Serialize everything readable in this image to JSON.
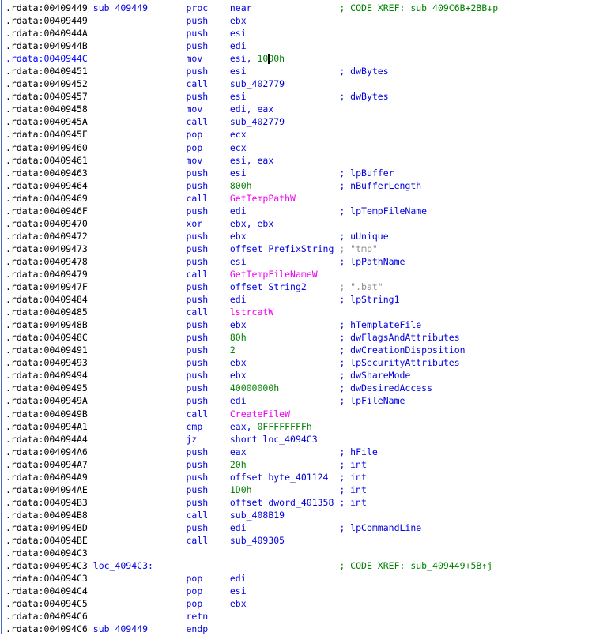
{
  "app": "disassembler-listing",
  "colors": {
    "k": "#000000",
    "b": "#0202e0",
    "g": "#008200",
    "m": "#ef00ef",
    "gy": "#8c8c8c",
    "hl": "#0000ff",
    "border": "#4a68c8",
    "background": "#ffffff"
  },
  "listing": {
    "section": ".rdata",
    "function": "sub_409449",
    "lines": [
      {
        "a": ".rdata:00409449",
        "n": "sub_409449",
        "m": "proc",
        "o": [
          [
            "b",
            "near"
          ]
        ],
        "c": "; CODE XREF: sub_409C6B+2BB↓p",
        "ct": "g"
      },
      {
        "a": ".rdata:00409449",
        "m": "push",
        "o": [
          [
            "b",
            "ebx"
          ]
        ]
      },
      {
        "a": ".rdata:0040944A",
        "m": "push",
        "o": [
          [
            "b",
            "esi"
          ]
        ]
      },
      {
        "a": ".rdata:0040944B",
        "m": "push",
        "o": [
          [
            "b",
            "edi"
          ]
        ]
      },
      {
        "a": ".rdata:0040944C",
        "hl": true,
        "m": "mov",
        "o": [
          [
            "b",
            "esi, "
          ],
          [
            "g",
            "1000h"
          ]
        ],
        "caret": 48
      },
      {
        "a": ".rdata:00409451",
        "m": "push",
        "o": [
          [
            "b",
            "esi"
          ]
        ],
        "c": "; dwBytes",
        "ct": "b"
      },
      {
        "a": ".rdata:00409452",
        "m": "call",
        "o": [
          [
            "b",
            "sub_402779"
          ]
        ]
      },
      {
        "a": ".rdata:00409457",
        "m": "push",
        "o": [
          [
            "b",
            "esi"
          ]
        ],
        "c": "; dwBytes",
        "ct": "b"
      },
      {
        "a": ".rdata:00409458",
        "m": "mov",
        "o": [
          [
            "b",
            "edi, eax"
          ]
        ]
      },
      {
        "a": ".rdata:0040945A",
        "m": "call",
        "o": [
          [
            "b",
            "sub_402779"
          ]
        ]
      },
      {
        "a": ".rdata:0040945F",
        "m": "pop",
        "o": [
          [
            "b",
            "ecx"
          ]
        ]
      },
      {
        "a": ".rdata:00409460",
        "m": "pop",
        "o": [
          [
            "b",
            "ecx"
          ]
        ]
      },
      {
        "a": ".rdata:00409461",
        "m": "mov",
        "o": [
          [
            "b",
            "esi, eax"
          ]
        ]
      },
      {
        "a": ".rdata:00409463",
        "m": "push",
        "o": [
          [
            "b",
            "esi"
          ]
        ],
        "c": "; lpBuffer",
        "ct": "b"
      },
      {
        "a": ".rdata:00409464",
        "m": "push",
        "o": [
          [
            "g",
            "800h"
          ]
        ],
        "c": "; nBufferLength",
        "ct": "b"
      },
      {
        "a": ".rdata:00409469",
        "m": "call",
        "o": [
          [
            "m",
            "GetTempPathW"
          ]
        ]
      },
      {
        "a": ".rdata:0040946F",
        "m": "push",
        "o": [
          [
            "b",
            "edi"
          ]
        ],
        "c": "; lpTempFileName",
        "ct": "b"
      },
      {
        "a": ".rdata:00409470",
        "m": "xor",
        "o": [
          [
            "b",
            "ebx, ebx"
          ]
        ]
      },
      {
        "a": ".rdata:00409472",
        "m": "push",
        "o": [
          [
            "b",
            "ebx"
          ]
        ],
        "c": "; uUnique",
        "ct": "b"
      },
      {
        "a": ".rdata:00409473",
        "m": "push",
        "o": [
          [
            "b",
            "offset PrefixString"
          ]
        ],
        "c": "; \"tmp\"",
        "ct": "gy"
      },
      {
        "a": ".rdata:00409478",
        "m": "push",
        "o": [
          [
            "b",
            "esi"
          ]
        ],
        "c": "; lpPathName",
        "ct": "b"
      },
      {
        "a": ".rdata:00409479",
        "m": "call",
        "o": [
          [
            "m",
            "GetTempFileNameW"
          ]
        ]
      },
      {
        "a": ".rdata:0040947F",
        "m": "push",
        "o": [
          [
            "b",
            "offset String2"
          ]
        ],
        "c": "; \".bat\"",
        "ct": "gy"
      },
      {
        "a": ".rdata:00409484",
        "m": "push",
        "o": [
          [
            "b",
            "edi"
          ]
        ],
        "c": "; lpString1",
        "ct": "b"
      },
      {
        "a": ".rdata:00409485",
        "m": "call",
        "o": [
          [
            "m",
            "lstrcatW"
          ]
        ]
      },
      {
        "a": ".rdata:0040948B",
        "m": "push",
        "o": [
          [
            "b",
            "ebx"
          ]
        ],
        "c": "; hTemplateFile",
        "ct": "b"
      },
      {
        "a": ".rdata:0040948C",
        "m": "push",
        "o": [
          [
            "g",
            "80h"
          ]
        ],
        "c": "; dwFlagsAndAttributes",
        "ct": "b"
      },
      {
        "a": ".rdata:00409491",
        "m": "push",
        "o": [
          [
            "g",
            "2"
          ]
        ],
        "c": "; dwCreationDisposition",
        "ct": "b"
      },
      {
        "a": ".rdata:00409493",
        "m": "push",
        "o": [
          [
            "b",
            "ebx"
          ]
        ],
        "c": "; lpSecurityAttributes",
        "ct": "b"
      },
      {
        "a": ".rdata:00409494",
        "m": "push",
        "o": [
          [
            "b",
            "ebx"
          ]
        ],
        "c": "; dwShareMode",
        "ct": "b"
      },
      {
        "a": ".rdata:00409495",
        "m": "push",
        "o": [
          [
            "g",
            "40000000h"
          ]
        ],
        "c": "; dwDesiredAccess",
        "ct": "b"
      },
      {
        "a": ".rdata:0040949A",
        "m": "push",
        "o": [
          [
            "b",
            "edi"
          ]
        ],
        "c": "; lpFileName",
        "ct": "b"
      },
      {
        "a": ".rdata:0040949B",
        "m": "call",
        "o": [
          [
            "m",
            "CreateFileW"
          ]
        ]
      },
      {
        "a": ".rdata:004094A1",
        "m": "cmp",
        "o": [
          [
            "b",
            "eax, "
          ],
          [
            "g",
            "0FFFFFFFFh"
          ]
        ]
      },
      {
        "a": ".rdata:004094A4",
        "m": "jz",
        "o": [
          [
            "b",
            "short loc_4094C3"
          ]
        ]
      },
      {
        "a": ".rdata:004094A6",
        "m": "push",
        "o": [
          [
            "b",
            "eax"
          ]
        ],
        "c": "; hFile",
        "ct": "b"
      },
      {
        "a": ".rdata:004094A7",
        "m": "push",
        "o": [
          [
            "g",
            "20h"
          ]
        ],
        "c": "; int",
        "ct": "b"
      },
      {
        "a": ".rdata:004094A9",
        "m": "push",
        "o": [
          [
            "b",
            "offset byte_401124"
          ]
        ],
        "c": "; int",
        "ct": "b"
      },
      {
        "a": ".rdata:004094AE",
        "m": "push",
        "o": [
          [
            "g",
            "1D0h"
          ]
        ],
        "c": "; int",
        "ct": "b"
      },
      {
        "a": ".rdata:004094B3",
        "m": "push",
        "o": [
          [
            "b",
            "offset dword_401358"
          ]
        ],
        "c": "; int",
        "ct": "b"
      },
      {
        "a": ".rdata:004094B8",
        "m": "call",
        "o": [
          [
            "b",
            "sub_408B19"
          ]
        ]
      },
      {
        "a": ".rdata:004094BD",
        "m": "push",
        "o": [
          [
            "b",
            "edi"
          ]
        ],
        "c": "; lpCommandLine",
        "ct": "b"
      },
      {
        "a": ".rdata:004094BE",
        "m": "call",
        "o": [
          [
            "b",
            "sub_409305"
          ]
        ]
      },
      {
        "a": ".rdata:004094C3"
      },
      {
        "a": ".rdata:004094C3",
        "n": "loc_4094C3:",
        "c": "; CODE XREF: sub_409449+5B↑j",
        "ct": "g"
      },
      {
        "a": ".rdata:004094C3",
        "m": "pop",
        "o": [
          [
            "b",
            "edi"
          ]
        ]
      },
      {
        "a": ".rdata:004094C4",
        "m": "pop",
        "o": [
          [
            "b",
            "esi"
          ]
        ]
      },
      {
        "a": ".rdata:004094C5",
        "m": "pop",
        "o": [
          [
            "b",
            "ebx"
          ]
        ]
      },
      {
        "a": ".rdata:004094C6",
        "m": "retn"
      },
      {
        "a": ".rdata:004094C6",
        "n": "sub_409449",
        "m": "endp"
      }
    ]
  }
}
